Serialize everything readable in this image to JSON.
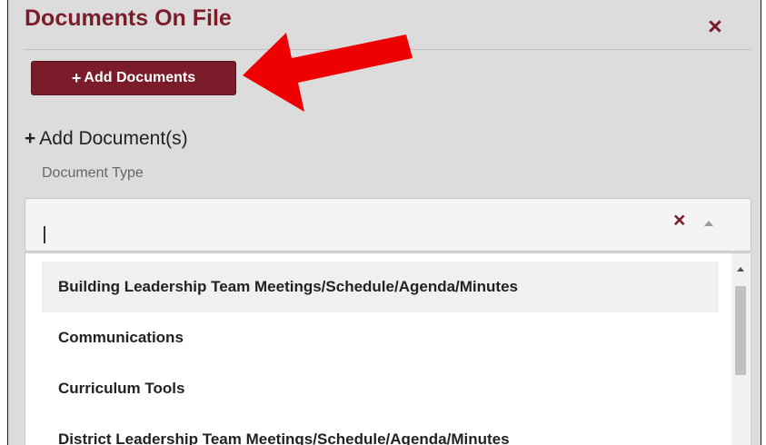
{
  "panel": {
    "title": "Documents On File",
    "close_label": "×"
  },
  "toolbar": {
    "add_icon": "+",
    "add_label": "Add Documents"
  },
  "annotation": {
    "arrow_color": "#ee0000"
  },
  "section": {
    "icon": "+",
    "title": "Add Document(s)"
  },
  "form": {
    "document_type_label": "Document Type",
    "document_type_value": "",
    "clear_label": "×"
  },
  "dropdown": {
    "options": [
      {
        "label": "Building Leadership Team Meetings/Schedule/Agenda/Minutes",
        "highlighted": true
      },
      {
        "label": "Communications",
        "highlighted": false
      },
      {
        "label": "Curriculum Tools",
        "highlighted": false
      },
      {
        "label": "District Leadership Team Meetings/Schedule/Agenda/Minutes",
        "highlighted": false
      }
    ]
  },
  "colors": {
    "brand": "#7b1c2b",
    "panel_bg": "#dcdcdc",
    "highlight_bg": "#f0f0f0"
  }
}
